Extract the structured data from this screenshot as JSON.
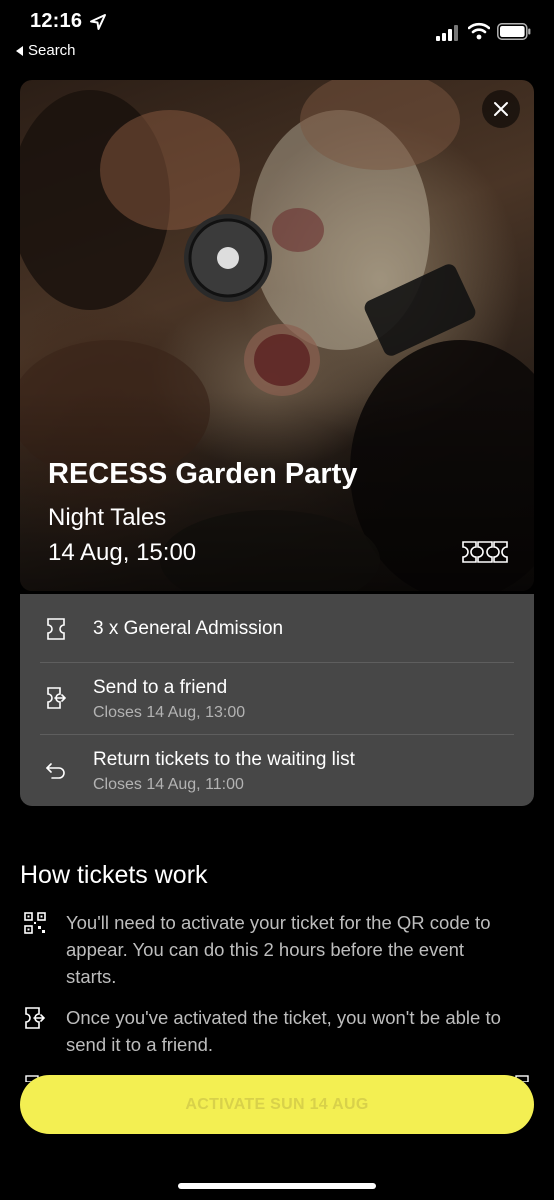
{
  "status_bar": {
    "time": "12:16",
    "back_label": "Search"
  },
  "event": {
    "title": "RECESS Garden Party",
    "venue": "Night Tales",
    "date": "14 Aug, 15:00"
  },
  "ticket_panel": {
    "admission": "3 x General Admission",
    "send": {
      "label": "Send to a friend",
      "closes": "Closes 14 Aug, 13:00"
    },
    "return": {
      "label": "Return tickets to the waiting list",
      "closes": "Closes 14 Aug, 11:00"
    }
  },
  "how_tickets_work": {
    "title": "How tickets work",
    "items": [
      {
        "icon": "qr-code-icon",
        "text": "You'll need to activate your ticket for the QR code to appear. You can do this 2 hours before the event starts."
      },
      {
        "icon": "send-ticket-icon",
        "text": "Once you've activated the ticket, you won't be able to send it to a friend."
      }
    ]
  },
  "activate_button": {
    "label": "ACTIVATE SUN 14 AUG"
  },
  "colors": {
    "accent_yellow": "#f3ef52",
    "panel_bg": "#474747",
    "background": "#000000"
  }
}
